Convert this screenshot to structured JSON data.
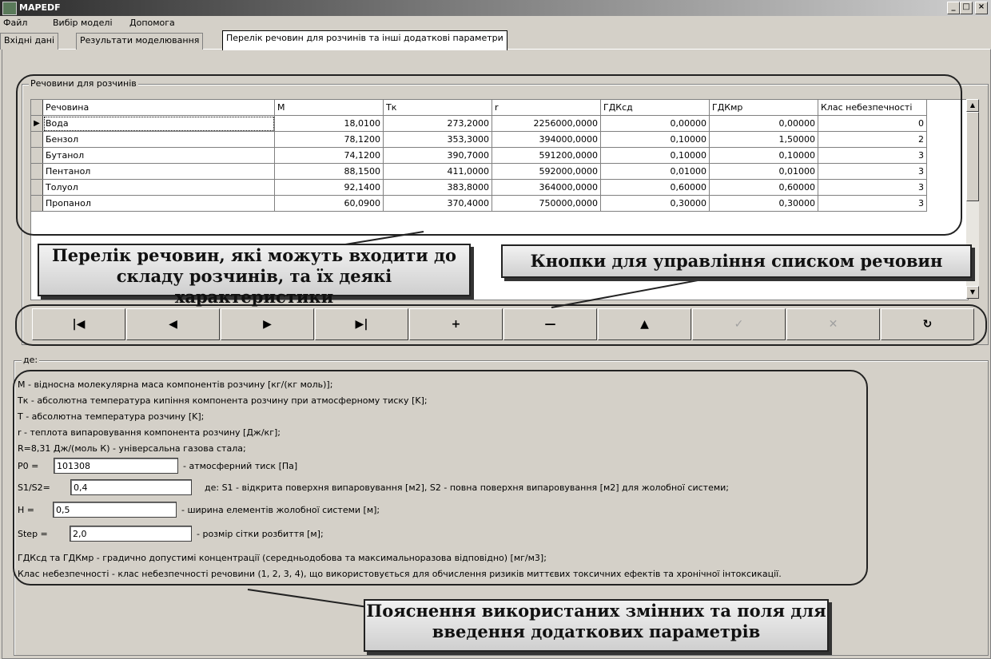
{
  "window": {
    "title": "MAPEDF",
    "min": "_",
    "max": "□",
    "close": "×"
  },
  "menu": [
    "Файл",
    "Вибір моделі",
    "Допомога"
  ],
  "tabs": [
    "Вхідні дані",
    "Результати моделювання",
    "Перелік речовин для розчинів та інші додаткові параметри"
  ],
  "substances_group": "Речовини для розчинів",
  "grid": {
    "columns": [
      "Речовина",
      "M",
      "Тк",
      "r",
      "ГДКсд",
      "ГДКмр",
      "Клас небезпечності"
    ],
    "rows": [
      [
        "Вода",
        "18,0100",
        "273,2000",
        "2256000,0000",
        "0,00000",
        "0,00000",
        "0"
      ],
      [
        "Бензол",
        "78,1200",
        "353,3000",
        "394000,0000",
        "0,10000",
        "1,50000",
        "2"
      ],
      [
        "Бутанол",
        "74,1200",
        "390,7000",
        "591200,0000",
        "0,10000",
        "0,10000",
        "3"
      ],
      [
        "Пентанол",
        "88,1500",
        "411,0000",
        "592000,0000",
        "0,01000",
        "0,01000",
        "3"
      ],
      [
        "Толуол",
        "92,1400",
        "383,8000",
        "364000,0000",
        "0,60000",
        "0,60000",
        "3"
      ],
      [
        "Пропанол",
        "60,0900",
        "370,4000",
        "750000,0000",
        "0,30000",
        "0,30000",
        "3"
      ]
    ],
    "row_indicator": "▶"
  },
  "navigator": [
    "|◀",
    "◀",
    "▶",
    "▶|",
    "+",
    "—",
    "▲",
    "✓",
    "✕",
    "↻"
  ],
  "callouts": {
    "list": "Перелік речовин, які можуть входити до складу розчинів, та їх деякі характеристики",
    "buttons": "Кнопки для управління списком речовин",
    "explanation": "Пояснення використаних змінних та поля для введення додаткових параметрів"
  },
  "where_group": "де:",
  "descriptions": {
    "m": "M - відносна молекулярна маса компонентів розчину [кг/(кг моль)];",
    "tk": "Тк - абсолютна температура кипіння компонента розчину при атмосферному тиску [K];",
    "t": "T - абсолютна температура розчину [K];",
    "r": "r - теплота випаровування компонента розчину [Дж/кг];",
    "R": "R=8,31 Дж/(моль К) - універсальна газова стала;",
    "p0_label": "P0 =",
    "p0_value": "101308",
    "p0_desc": "- атмосферний тиск  [Па]",
    "s_label": "S1/S2=",
    "s_value": "0,4",
    "s_desc": "де: S1 - відкрита поверхня випаровування [м2],  S2 - повна поверхня випаровування [м2] для жолобної системи;",
    "h_label": "H =",
    "h_value": "0,5",
    "h_desc": "- ширина елементів жолобної системи [м];",
    "step_label": "Step =",
    "step_value": "2,0",
    "step_desc": "- розмір сітки розбиття [м];",
    "gdk": "ГДКсд та ГДКмр - градично допустимі концентрації (середньодобова та максимальноразова відповідно) [мг/м3];",
    "klas": "Клас небезпечності - клас небезпечності речовини (1, 2, 3, 4), що використовується для обчислення ризиків миттєвих токсичних ефектів та хронічної інтоксикації."
  }
}
